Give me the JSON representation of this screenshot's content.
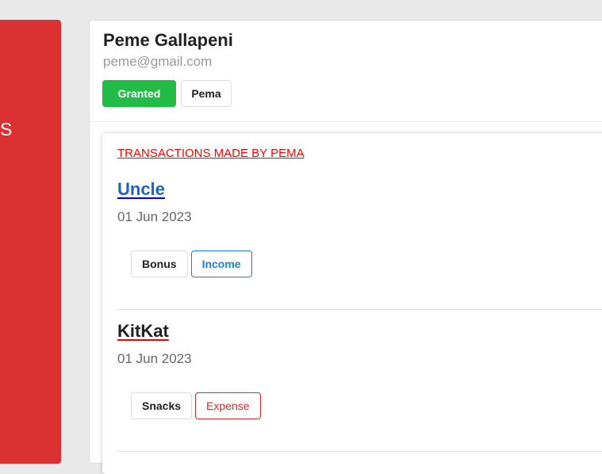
{
  "sidebar": {
    "partial_text": "S"
  },
  "user": {
    "name": "Peme Gallapeni",
    "email": "peme@gmail.com",
    "status_label": "Granted",
    "tag_label": "Pema"
  },
  "transactions": {
    "title": "TRANSACTIONS MADE BY PEMA",
    "items": [
      {
        "name": "Uncle",
        "date": "01 Jun 2023",
        "category": "Bonus",
        "type": "Income",
        "type_color": "#1d7fd6",
        "name_color": "#1d63c4",
        "underline_color": "#0000ee"
      },
      {
        "name": "KitKat",
        "date": "01 Jun 2023",
        "category": "Snacks",
        "type": "Expense",
        "type_color": "#dc2b2b",
        "name_color": "#222222",
        "underline_color": "#ee0000"
      }
    ]
  }
}
